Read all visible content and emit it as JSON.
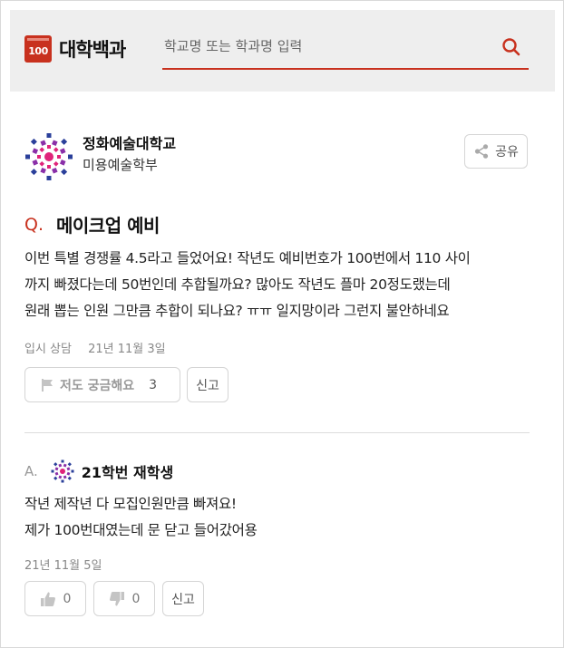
{
  "header": {
    "logo_badge": "100",
    "logo_text": "대학백과",
    "search_placeholder": "학교명 또는 학과명 입력",
    "search_icon": "search-icon",
    "accent_color": "#c8311e"
  },
  "school": {
    "name": "정화예술대학교",
    "department": "미용예술학부",
    "share_label": "공유",
    "share_icon": "share-icon"
  },
  "question": {
    "mark": "Q.",
    "title": "메이크업 예비",
    "body_lines": [
      "이번 특별 경쟁률 4.5라고 들었어요! 작년도 예비번호가 100번에서 110 사이",
      "까지 빠졌다는데 50번인데 추합될까요? 많아도 작년도 플마 20정도랬는데",
      "원래 뽑는 인원 그만큼 추합이 되나요? ㅠㅠ 일지망이라 그런지 불안하네요"
    ],
    "category": "입시 상담",
    "date": "21년 11월 3일",
    "curious_label": "저도 궁금해요",
    "curious_count": "3",
    "report_label": "신고"
  },
  "answer": {
    "mark": "A.",
    "author": "21학번 재학생",
    "body_lines": [
      "작년 제작년 다 모집인원만큼 빠져요!",
      "제가 100번대였는데 문 닫고 들어갔어용"
    ],
    "date": "21년 11월 5일",
    "like_count": "0",
    "dislike_count": "0",
    "report_label": "신고"
  }
}
